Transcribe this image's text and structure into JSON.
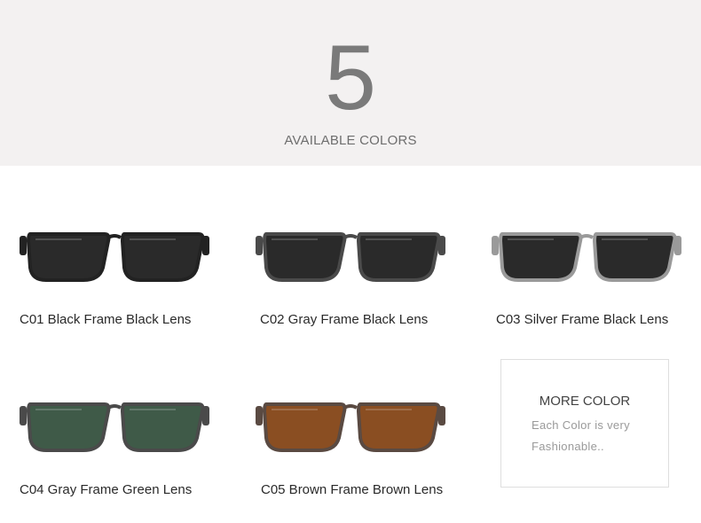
{
  "header": {
    "count": "5",
    "subtitle": "AVAILABLE COLORS"
  },
  "products": [
    {
      "code": "C01",
      "label": "C01 Black Frame Black Lens",
      "frame_color": "#222222",
      "lens_color": "#2a2a2a"
    },
    {
      "code": "C02",
      "label": "C02 Gray Frame Black Lens",
      "frame_color": "#4a4a4a",
      "lens_color": "#2a2a2a"
    },
    {
      "code": "C03",
      "label": "C03 Silver Frame Black Lens",
      "frame_color": "#9a9a9a",
      "lens_color": "#2a2a2a"
    },
    {
      "code": "C04",
      "label": "C04 Gray Frame Green Lens",
      "frame_color": "#4a4a4a",
      "lens_color": "#3f5a48"
    },
    {
      "code": "C05",
      "label": "C05 Brown Frame Brown Lens",
      "frame_color": "#5a4a42",
      "lens_color": "#8a4e22"
    }
  ],
  "more_color": {
    "title": "MORE COLOR",
    "line1": "Each Color is very",
    "line2": "Fashionable.."
  }
}
